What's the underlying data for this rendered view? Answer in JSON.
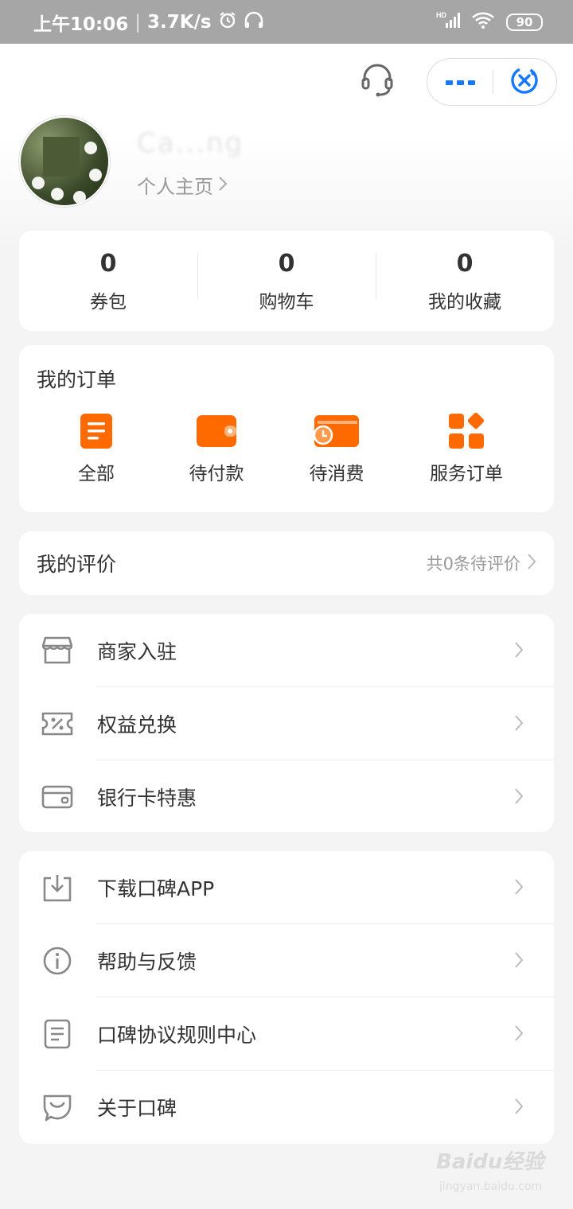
{
  "status_bar": {
    "time": "上午10:06",
    "network_speed": "3.7K/s",
    "battery": "90",
    "icons": [
      "alarm-icon",
      "headphones-icon",
      "signal-icon",
      "wifi-icon",
      "battery-icon"
    ]
  },
  "header": {
    "username": "Ca...ng",
    "profile_link": "个人主页",
    "icons": [
      "customer-service-icon",
      "more-icon",
      "close-miniapp-icon"
    ]
  },
  "stats": [
    {
      "value": "0",
      "label": "券包"
    },
    {
      "value": "0",
      "label": "购物车"
    },
    {
      "value": "0",
      "label": "我的收藏"
    }
  ],
  "orders": {
    "title": "我的订单",
    "items": [
      {
        "label": "全部",
        "icon": "order-list-icon"
      },
      {
        "label": "待付款",
        "icon": "wallet-icon"
      },
      {
        "label": "待消费",
        "icon": "ticket-clock-icon"
      },
      {
        "label": "服务订单",
        "icon": "grid-service-icon"
      }
    ]
  },
  "review": {
    "title": "我的评价",
    "subtitle": "共0条待评价"
  },
  "menu_group_1": [
    {
      "label": "商家入驻",
      "icon": "store-icon"
    },
    {
      "label": "权益兑换",
      "icon": "coupon-percent-icon"
    },
    {
      "label": "银行卡特惠",
      "icon": "bank-card-icon"
    }
  ],
  "menu_group_2": [
    {
      "label": "下载口碑APP",
      "icon": "download-icon"
    },
    {
      "label": "帮助与反馈",
      "icon": "info-icon"
    },
    {
      "label": "口碑协议规则中心",
      "icon": "document-icon"
    },
    {
      "label": "关于口碑",
      "icon": "koubei-logo-icon"
    }
  ],
  "colors": {
    "accent_orange": "#ff6a00",
    "accent_blue": "#1677ff"
  },
  "watermark": {
    "text": "Baidu经验",
    "sub": "jingyan.baidu.com"
  }
}
